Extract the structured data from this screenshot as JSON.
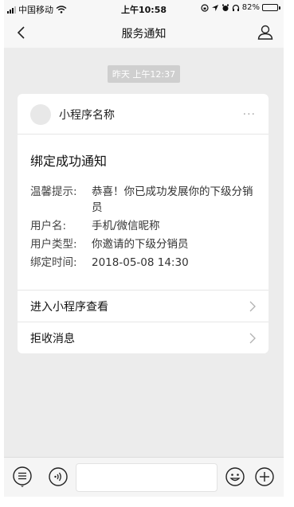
{
  "status_bar": {
    "carrier": "中国移动",
    "time": "上午10:58",
    "battery": "82%",
    "battery_level": 0.82
  },
  "nav": {
    "title": "服务通知"
  },
  "message": {
    "timestamp": "昨天 上午12:37"
  },
  "card": {
    "app_name": "小程序名称",
    "more": "···",
    "title": "绑定成功通知",
    "fields": [
      {
        "label": "温馨提示:",
        "value": "恭喜！你已成功发展你的下级分销员"
      },
      {
        "label": "用户名:",
        "value": "手机/微信昵称"
      },
      {
        "label": "用户类型:",
        "value": "你邀请的下级分销员"
      },
      {
        "label": "绑定时间:",
        "value": "2018-05-08 14:30"
      }
    ],
    "actions": [
      {
        "label": "进入小程序查看"
      },
      {
        "label": "拒收消息"
      }
    ]
  },
  "colors": {
    "background": "#ececec",
    "bar": "#f7f7f7",
    "card": "#ffffff",
    "timestamp_bg": "#cfcfcf"
  },
  "icons": [
    "wifi-icon",
    "signal-icon",
    "back-arrow-icon",
    "user-icon",
    "more-icon",
    "chevron-right-icon",
    "menu-icon",
    "voice-icon",
    "emoji-icon",
    "plus-icon"
  ]
}
